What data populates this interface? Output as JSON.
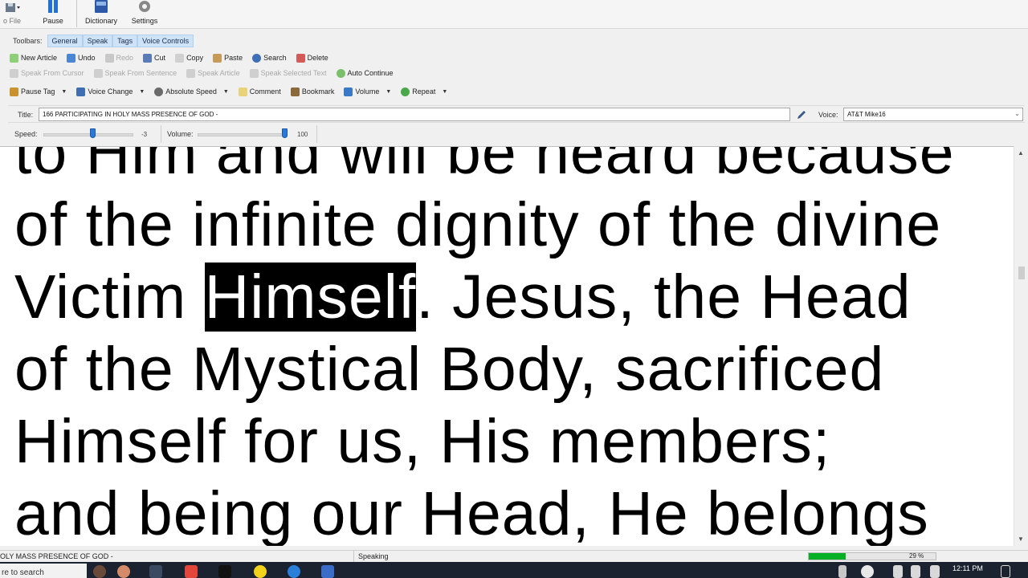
{
  "ribbon": {
    "file_label": "o File",
    "pause_label": "Pause",
    "dictionary_label": "Dictionary",
    "settings_label": "Settings"
  },
  "toolbars": {
    "label": "Toolbars:",
    "tabs": [
      "General",
      "Speak",
      "Tags",
      "Voice Controls"
    ]
  },
  "edit_row": {
    "new_article": "New Article",
    "undo": "Undo",
    "redo": "Redo",
    "cut": "Cut",
    "copy": "Copy",
    "paste": "Paste",
    "search": "Search",
    "delete": "Delete"
  },
  "speak_row": {
    "from_cursor": "Speak From Cursor",
    "from_sentence": "Speak From Sentence",
    "article": "Speak Article",
    "selected": "Speak Selected Text",
    "auto_continue": "Auto Continue"
  },
  "tags_row": {
    "pause_tag": "Pause Tag",
    "voice_change": "Voice Change",
    "absolute_speed": "Absolute Speed",
    "comment": "Comment",
    "bookmark": "Bookmark",
    "volume": "Volume",
    "repeat": "Repeat"
  },
  "title_row": {
    "title_label": "Title:",
    "title_value": "166 PARTICIPATING IN HOLY MASS PRESENCE OF GOD -",
    "voice_label": "Voice:",
    "voice_value": "AT&T Mike16"
  },
  "sliders": {
    "speed_label": "Speed:",
    "speed_value": "-3",
    "speed_level": 0.55,
    "volume_label": "Volume:",
    "volume_value": "100",
    "volume_level": 1.0
  },
  "document": {
    "lines": [
      [
        "to Him and will be heard because"
      ],
      [
        "of the infinite dignity of the divine"
      ],
      [
        "Victim ",
        "Himself",
        ". Jesus, the Head"
      ],
      [
        "of the Mystical Body, sacrificed"
      ],
      [
        "Himself for us, His members;"
      ],
      [
        "and being our Head, He belongs"
      ]
    ],
    "highlighted_word": "Himself"
  },
  "status": {
    "title_text": "OLY MASS PRESENCE OF GOD -",
    "state": "Speaking",
    "progress_percent": "29 %",
    "progress_level": 0.29
  },
  "taskbar": {
    "search_placeholder": "re to search",
    "time": "12:11 PM"
  },
  "colors": {
    "accent_blue": "#2a78d8",
    "tab_bg": "#cfe3f8",
    "progress_green": "#06b025",
    "taskbar_bg": "#1b2330"
  }
}
